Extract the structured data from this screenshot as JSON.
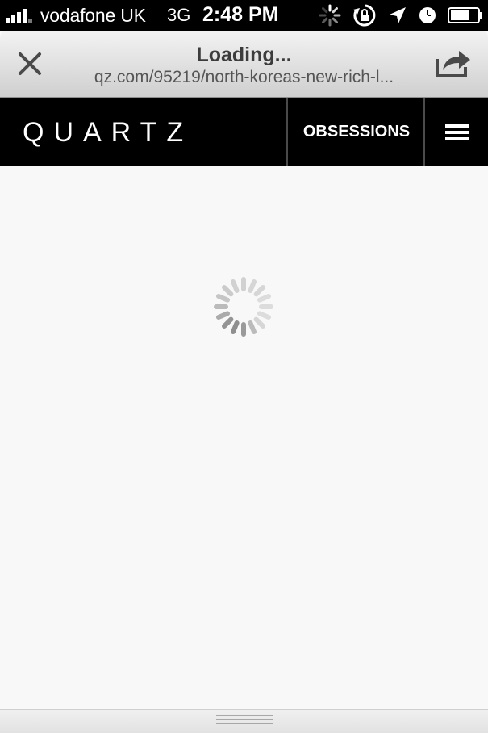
{
  "status_bar": {
    "carrier": "vodafone UK",
    "network": "3G",
    "time": "2:48 PM",
    "icons": [
      "signal-bars-icon",
      "activity-spinner-icon",
      "rotation-lock-icon",
      "location-arrow-icon",
      "alarm-clock-icon",
      "battery-icon"
    ]
  },
  "browser": {
    "title": "Loading...",
    "url": "qz.com/95219/north-koreas-new-rich-l...",
    "close_icon": "close-icon",
    "share_icon": "share-icon"
  },
  "site_header": {
    "logo": "QUARTZ",
    "nav_label": "OBSESSIONS",
    "menu_icon": "hamburger-menu-icon"
  },
  "content": {
    "loading_icon": "loading-spinner-icon"
  },
  "colors": {
    "header_background": "#000000",
    "content_background": "#f8f8f8",
    "toolbar_gradient_top": "#f3f3f3",
    "toolbar_gradient_bottom": "#cfcfcf"
  }
}
